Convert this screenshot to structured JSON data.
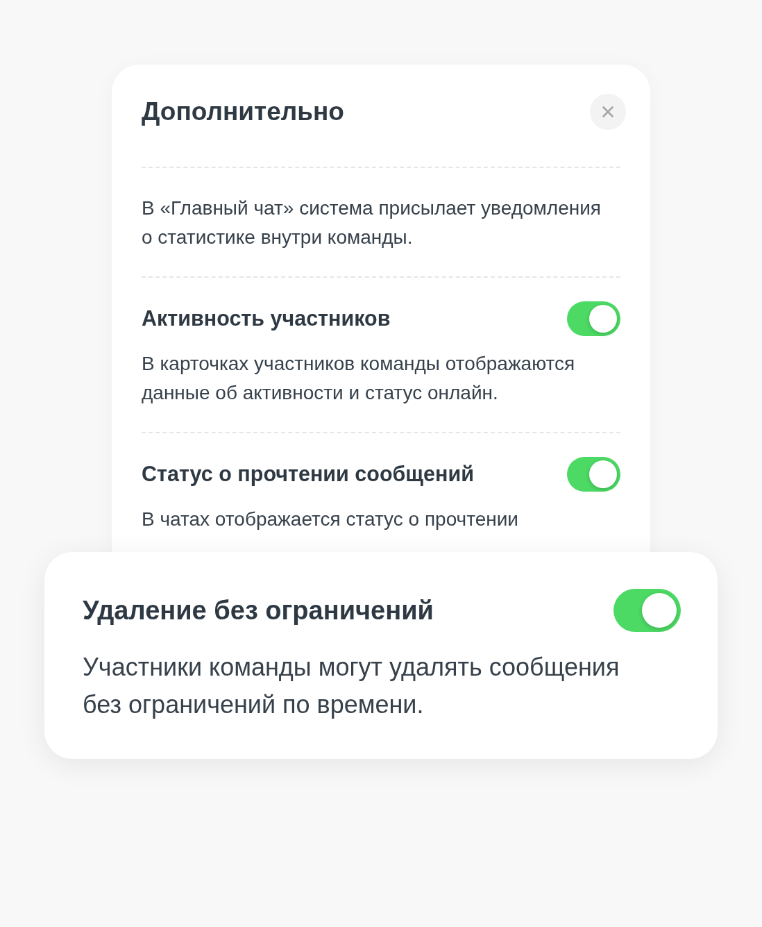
{
  "dialog": {
    "title": "Дополнительно",
    "intro": "В «Главный чат» система присылает уведомления о статистике внутри команды.",
    "settings": [
      {
        "title": "Активность участников",
        "description": "В карточках участников команды отображаются данные об активности и статус онлайн.",
        "on": true
      },
      {
        "title": "Статус о прочтении сообщений",
        "description": "В чатах отображается статус о прочтении",
        "on": true
      }
    ]
  },
  "highlighted_setting": {
    "title": "Удаление без ограничений",
    "description": "Участники команды могут удалять сообщения без ограничений по времени.",
    "on": true
  }
}
